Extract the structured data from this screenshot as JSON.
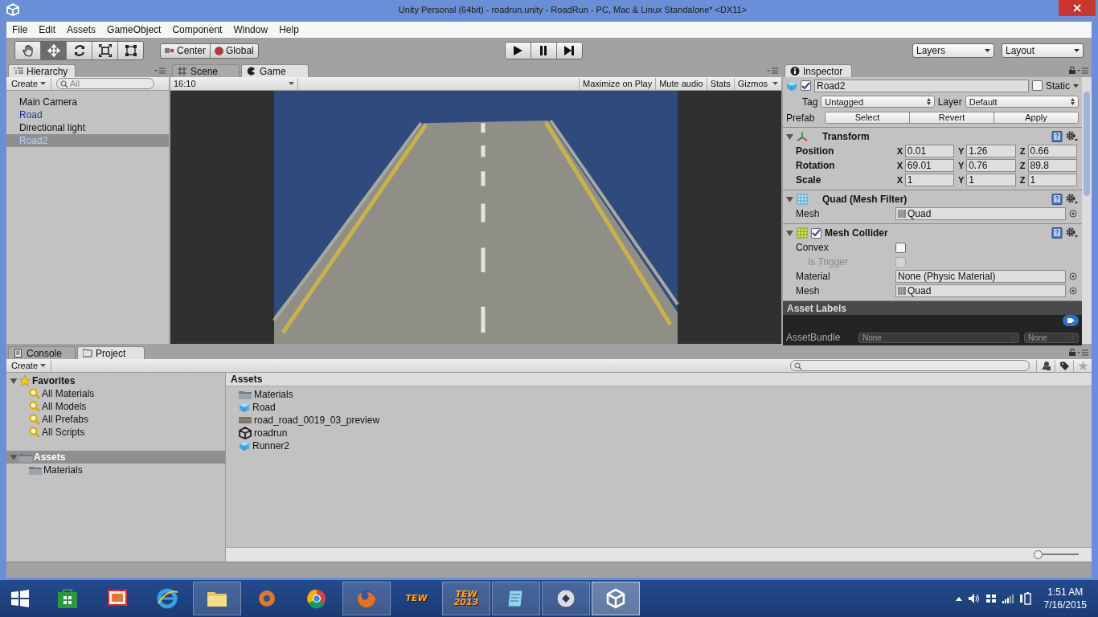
{
  "window": {
    "title": "Unity Personal (64bit) - roadrun.unity - RoadRun - PC, Mac & Linux Standalone* <DX11>"
  },
  "menu": [
    "File",
    "Edit",
    "Assets",
    "GameObject",
    "Component",
    "Window",
    "Help"
  ],
  "toolbar": {
    "tools": [
      {
        "kind": "hand",
        "selected": false
      },
      {
        "kind": "move",
        "selected": true
      },
      {
        "kind": "rotate",
        "selected": false
      },
      {
        "kind": "scale",
        "selected": false
      },
      {
        "kind": "rect",
        "selected": false
      }
    ],
    "pivot": [
      {
        "kind": "pivot",
        "label": "Center"
      },
      {
        "kind": "global",
        "label": "Global"
      }
    ],
    "playback": [
      {
        "kind": "play"
      },
      {
        "kind": "pause"
      },
      {
        "kind": "step"
      }
    ],
    "dropdowns": [
      "Layers",
      "Layout"
    ]
  },
  "hierarchy": {
    "tab": "Hierarchy",
    "create": "Create",
    "search_placeholder": "All",
    "items": [
      {
        "label": "Main Camera",
        "prefab": false,
        "selected": false
      },
      {
        "label": "Road",
        "prefab": true,
        "selected": false
      },
      {
        "label": "Directional light",
        "prefab": false,
        "selected": false
      },
      {
        "label": "Road2",
        "prefab": true,
        "selected": true
      }
    ]
  },
  "game": {
    "tabs": [
      {
        "kind": "scene",
        "label": "Scene",
        "selected": false
      },
      {
        "kind": "game",
        "label": "Game",
        "selected": true
      }
    ],
    "aspect": "16:10",
    "buttons": [
      {
        "label": "Maximize on Play",
        "dropdown": false
      },
      {
        "label": "Mute audio",
        "dropdown": false
      },
      {
        "label": "Stats",
        "dropdown": false
      },
      {
        "label": "Gizmos",
        "dropdown": true
      }
    ]
  },
  "inspector": {
    "tab": "Inspector",
    "active": true,
    "name": "Road2",
    "static_label": "Static",
    "static": false,
    "tag_label": "Tag",
    "tag": "Untagged",
    "layer_label": "Layer",
    "layer": "Default",
    "prefab_label": "Prefab",
    "prefab_buttons": [
      "Select",
      "Revert",
      "Apply"
    ],
    "components": [
      {
        "kind": "transform",
        "title": "Transform",
        "expanded": true,
        "rows": [
          {
            "label": "Position",
            "values": [
              {
                "axis": "X",
                "value": "0.01"
              },
              {
                "axis": "Y",
                "value": "1.26"
              },
              {
                "axis": "Z",
                "value": "0.66"
              }
            ]
          },
          {
            "label": "Rotation",
            "values": [
              {
                "axis": "X",
                "value": "69.01"
              },
              {
                "axis": "Y",
                "value": "0.76"
              },
              {
                "axis": "Z",
                "value": "89.8"
              }
            ]
          },
          {
            "label": "Scale",
            "values": [
              {
                "axis": "X",
                "value": "1"
              },
              {
                "axis": "Y",
                "value": "1"
              },
              {
                "axis": "Z",
                "value": "1"
              }
            ]
          }
        ]
      },
      {
        "kind": "mesh_filter",
        "title": "Quad (Mesh Filter)",
        "expanded": true,
        "rows": [
          {
            "kind": "mesh",
            "label": "Mesh",
            "value": "Quad"
          }
        ]
      },
      {
        "kind": "collider",
        "title": "Mesh Collider",
        "expanded": true,
        "enabled": true,
        "rows": [
          {
            "kind": "checkbox",
            "label": "Convex",
            "checked": false,
            "disabled": false
          },
          {
            "kind": "checkbox",
            "label": "Is Trigger",
            "checked": false,
            "disabled": true
          },
          {
            "kind": "object",
            "label": "Material",
            "value": "None (Physic Material)"
          },
          {
            "kind": "mesh",
            "label": "Mesh",
            "value": "Quad"
          }
        ]
      }
    ],
    "asset_labels": {
      "title": "Asset Labels",
      "bundle_label": "AssetBundle",
      "bundle": "None",
      "variant": "None"
    }
  },
  "project": {
    "tabs": [
      {
        "kind": "console",
        "label": "Console",
        "selected": false
      },
      {
        "kind": "project",
        "label": "Project",
        "selected": true
      }
    ],
    "create": "Create",
    "tree": [
      {
        "kind": "favorites",
        "label": "Favorites",
        "expanded": true,
        "selected": false,
        "children": [
          {
            "kind": "search",
            "label": "All Materials",
            "selected": false
          },
          {
            "kind": "search",
            "label": "All Models",
            "selected": false
          },
          {
            "kind": "search",
            "label": "All Prefabs",
            "selected": false
          },
          {
            "kind": "search",
            "label": "All Scripts",
            "selected": false
          }
        ]
      },
      {
        "kind": "folder",
        "label": "Assets",
        "expanded": true,
        "selected": true,
        "children": [
          {
            "kind": "folder",
            "label": "Materials",
            "selected": false
          }
        ]
      }
    ],
    "assets_header": "Assets",
    "assets": [
      {
        "kind": "folder",
        "label": "Materials"
      },
      {
        "kind": "prefab",
        "label": "Road"
      },
      {
        "kind": "texture",
        "label": "road_road_0019_03_preview"
      },
      {
        "kind": "scene",
        "label": "roadrun"
      },
      {
        "kind": "prefab",
        "label": "Runner2"
      }
    ],
    "zoom": {
      "level": 0
    }
  },
  "taskbar": {
    "apps": [
      {
        "kind": "store",
        "running": false,
        "selected": false
      },
      {
        "kind": "photos",
        "running": false,
        "selected": false
      },
      {
        "kind": "ie",
        "running": false,
        "selected": false
      },
      {
        "kind": "explorer",
        "running": true,
        "selected": false
      },
      {
        "kind": "media",
        "running": false,
        "selected": false
      },
      {
        "kind": "chrome",
        "running": false,
        "selected": false
      },
      {
        "kind": "firefox",
        "running": true,
        "selected": false
      },
      {
        "kind": "logo",
        "label": "TEW",
        "running": false,
        "selected": false
      },
      {
        "kind": "logo",
        "label": "TEW 2013",
        "running": true,
        "selected": false
      },
      {
        "kind": "notepad",
        "running": true,
        "selected": false
      },
      {
        "kind": "remote",
        "running": true,
        "selected": false
      },
      {
        "kind": "unity",
        "running": true,
        "selected": true
      }
    ],
    "time": "1:51 AM",
    "date": "7/16/2015"
  }
}
